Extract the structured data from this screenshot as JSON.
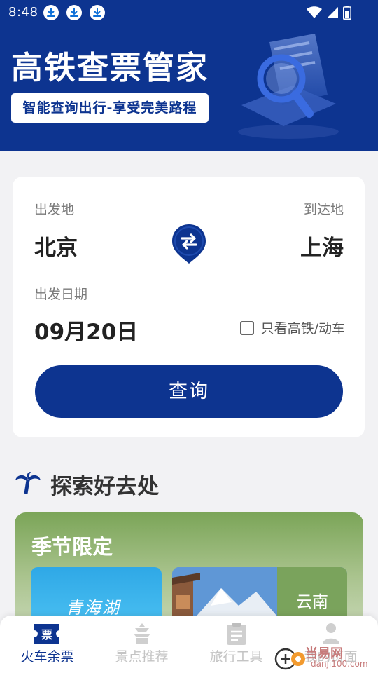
{
  "status_bar": {
    "time": "8:48",
    "download_icons": [
      "download-icon",
      "download-icon",
      "download-icon"
    ],
    "system_icons": [
      "wifi-icon",
      "signal-icon",
      "battery-icon"
    ]
  },
  "header": {
    "title": "高铁查票管家",
    "slogan": "智能查询出行-享受完美路程",
    "bg_color": "#0d3490"
  },
  "search": {
    "from_label": "出发地",
    "from_city": "北京",
    "to_label": "到达地",
    "to_city": "上海",
    "date_label": "出发日期",
    "date": "09月20日",
    "high_speed_only_label": "只看高铁/动车",
    "high_speed_only_checked": false,
    "query_button": "查询",
    "swap_icon": "swap-icon"
  },
  "explore": {
    "title": "探索好去处",
    "season": {
      "title": "季节限定",
      "tiles": [
        {
          "label": "青海湖"
        },
        {
          "label": "云南"
        }
      ]
    }
  },
  "bottom_nav": {
    "items": [
      {
        "label": "火车余票",
        "icon": "ticket-icon",
        "active": true
      },
      {
        "label": "景点推荐",
        "icon": "pagoda-icon",
        "active": false
      },
      {
        "label": "旅行工具",
        "icon": "clipboard-icon",
        "active": false
      },
      {
        "label": "我的页面",
        "icon": "user-icon",
        "active": false
      }
    ]
  },
  "watermark": {
    "text": "当易网",
    "sub": "danji100.com"
  }
}
